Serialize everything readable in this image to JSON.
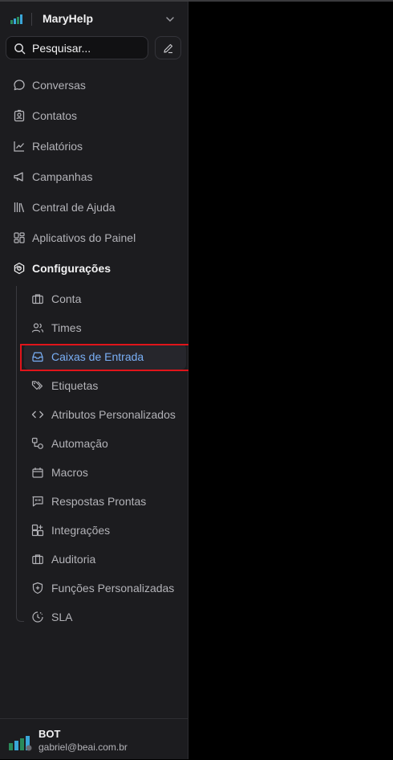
{
  "header": {
    "app_name": "MaryHelp"
  },
  "search": {
    "placeholder": "Pesquisar..."
  },
  "nav": {
    "items": [
      {
        "label": "Conversas"
      },
      {
        "label": "Contatos"
      },
      {
        "label": "Relatórios"
      },
      {
        "label": "Campanhas"
      },
      {
        "label": "Central de Ajuda"
      },
      {
        "label": "Aplicativos do Painel"
      },
      {
        "label": "Configurações"
      }
    ],
    "settings": [
      {
        "label": "Conta"
      },
      {
        "label": "Times"
      },
      {
        "label": "Caixas de Entrada"
      },
      {
        "label": "Etiquetas"
      },
      {
        "label": "Atributos Personalizados"
      },
      {
        "label": "Automação"
      },
      {
        "label": "Macros"
      },
      {
        "label": "Respostas Prontas"
      },
      {
        "label": "Integrações"
      },
      {
        "label": "Auditoria"
      },
      {
        "label": "Funções Personalizadas"
      },
      {
        "label": "SLA"
      }
    ]
  },
  "user": {
    "name": "BOT",
    "email": "gabriel@beai.com.br"
  },
  "colors": {
    "sidebar_bg": "#1c1c1f",
    "active_text": "#7ab0f7",
    "highlight_border": "#e0141a"
  }
}
